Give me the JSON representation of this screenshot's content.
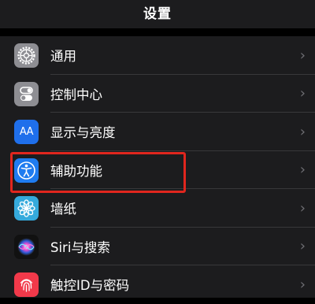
{
  "header": {
    "title": "设置"
  },
  "settings": {
    "items": [
      {
        "label": "通用",
        "icon": "gear-icon"
      },
      {
        "label": "控制中心",
        "icon": "toggles-icon"
      },
      {
        "label": "显示与亮度",
        "icon": "display-icon",
        "icon_text": "AA"
      },
      {
        "label": "辅助功能",
        "icon": "accessibility-icon"
      },
      {
        "label": "墙纸",
        "icon": "flower-icon"
      },
      {
        "label": "Siri与搜索",
        "icon": "siri-icon"
      },
      {
        "label": "触控ID与密码",
        "icon": "fingerprint-icon"
      }
    ]
  },
  "chevron": "›",
  "colors": {
    "background": "#000000",
    "cell": "#1c1c1e",
    "highlight": "#e0261e",
    "accessibility_blue": "#1f7cf0",
    "fingerprint_red": "#f2394a"
  }
}
